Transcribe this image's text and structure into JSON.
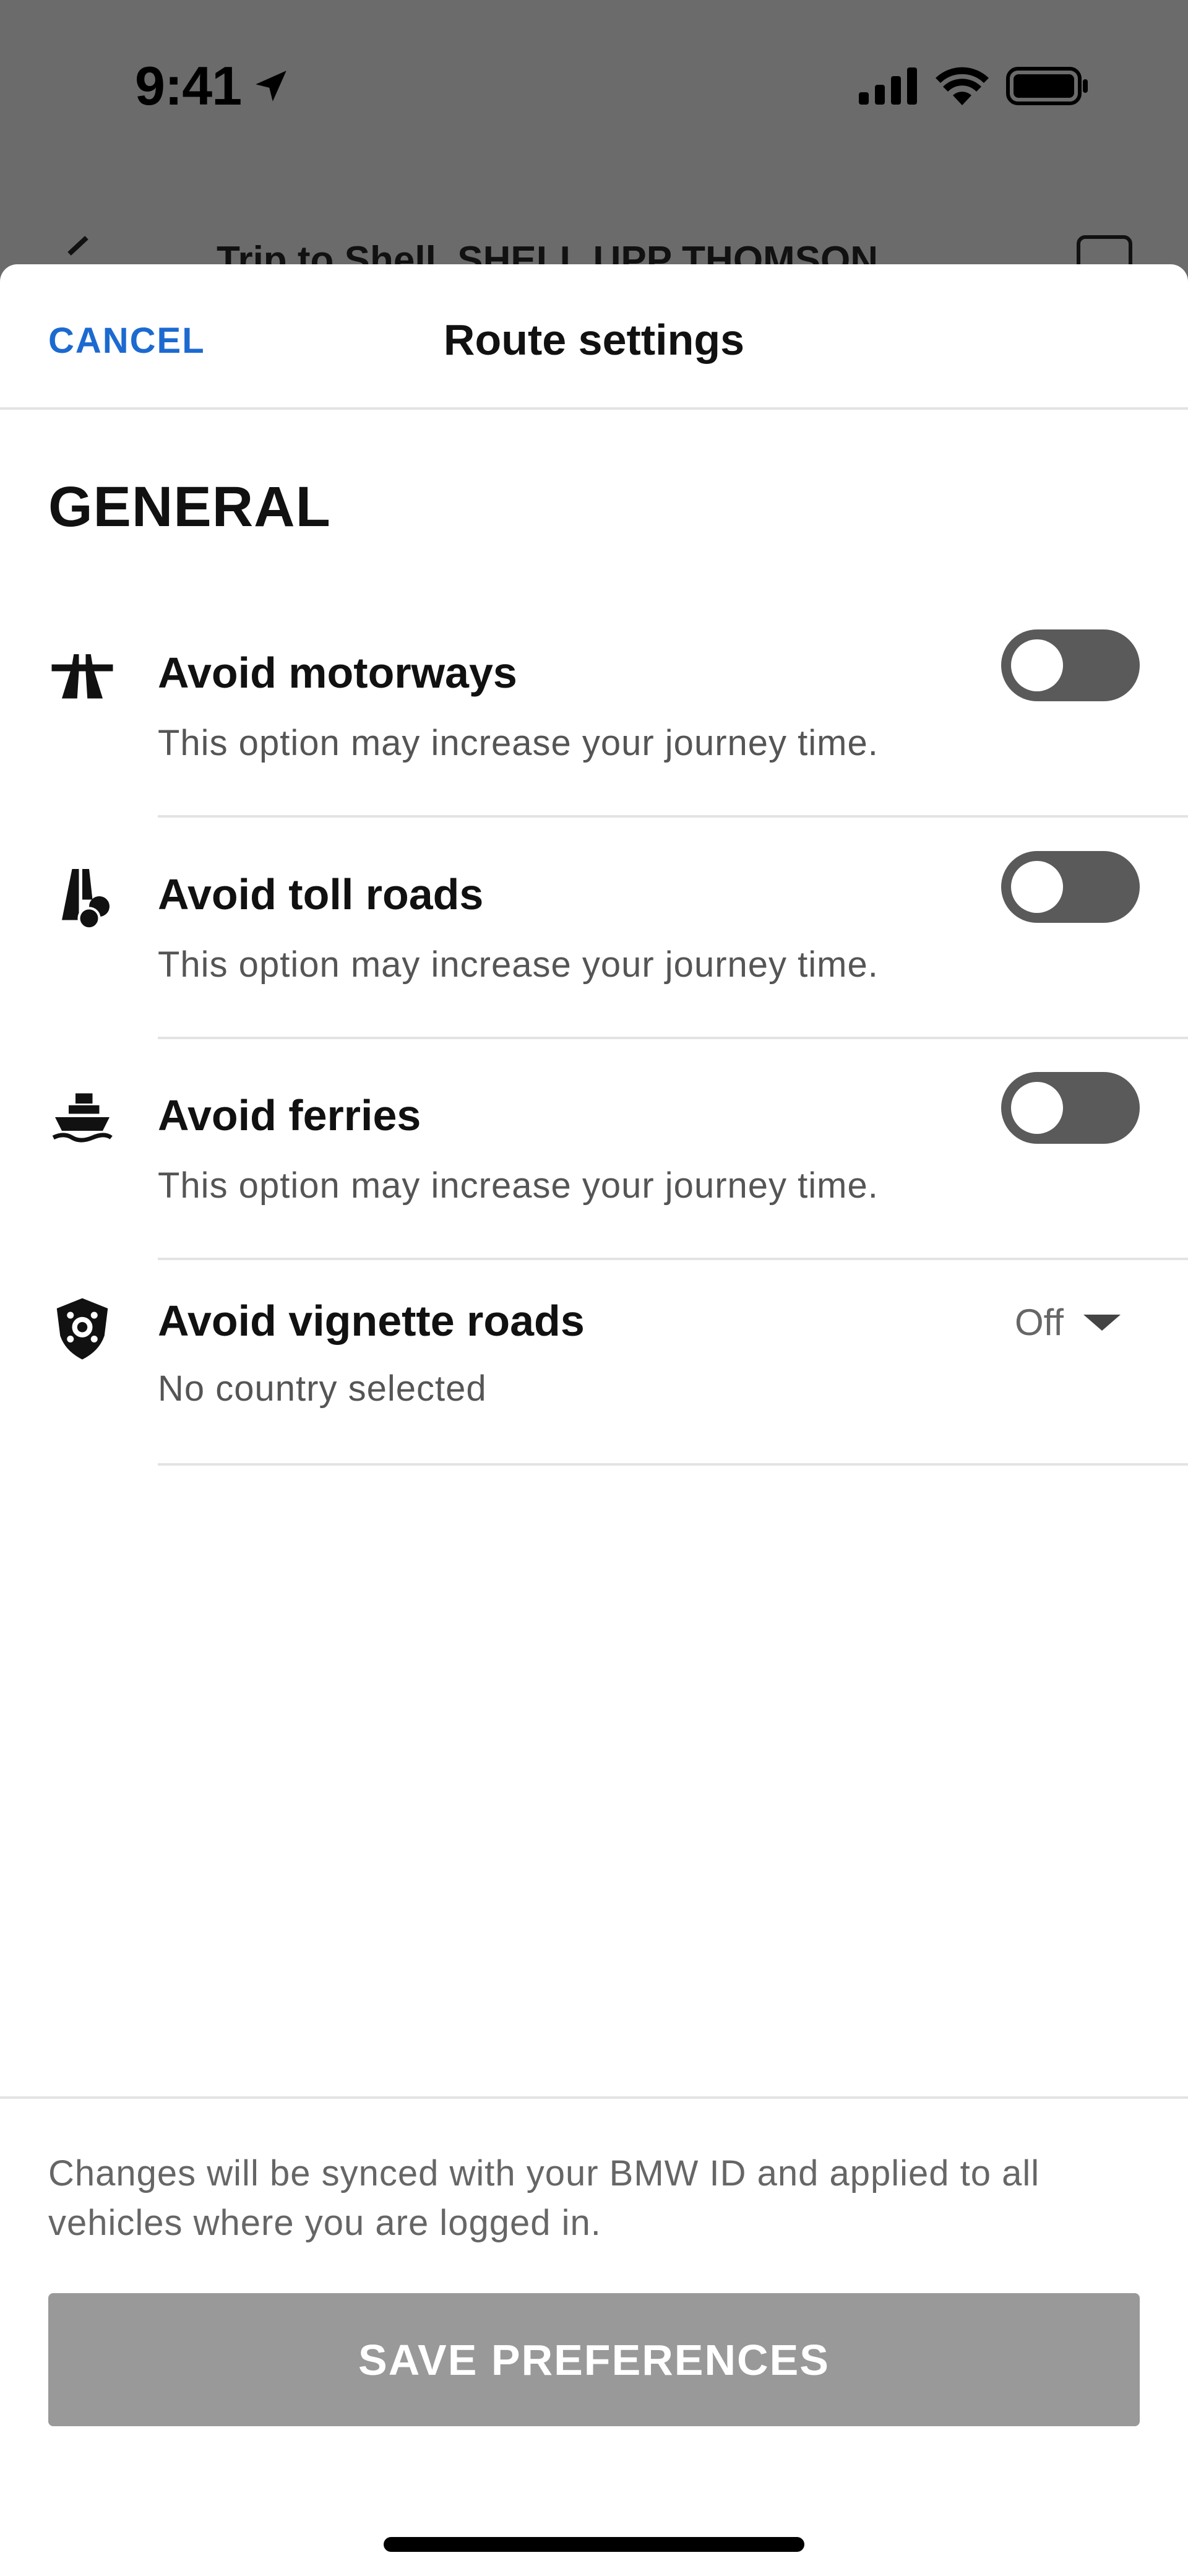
{
  "status_bar": {
    "time": "9:41"
  },
  "behind_screen": {
    "title": "Trip to Shell, SHELL UPP THOMSON..."
  },
  "header": {
    "cancel_label": "CANCEL",
    "title": "Route settings"
  },
  "section": {
    "title": "GENERAL"
  },
  "options": [
    {
      "title": "Avoid motorways",
      "subtitle": "This option may increase your journey time.",
      "icon": "motorway-icon",
      "enabled": false
    },
    {
      "title": "Avoid toll roads",
      "subtitle": "This option may increase your journey time.",
      "icon": "toll-road-icon",
      "enabled": false
    },
    {
      "title": "Avoid ferries",
      "subtitle": "This option may increase your journey time.",
      "icon": "ferry-icon",
      "enabled": false
    },
    {
      "title": "Avoid vignette roads",
      "subtitle": "No country selected",
      "icon": "vignette-shield-icon",
      "value": "Off"
    }
  ],
  "footer": {
    "note": "Changes will be synced with your BMW ID and applied to all vehicles where you are logged in.",
    "save_label": "SAVE PREFERENCES"
  },
  "colors": {
    "accent": "#1c6ad0",
    "toggle_off": "#5a5a5a",
    "button_disabled": "#999999"
  }
}
